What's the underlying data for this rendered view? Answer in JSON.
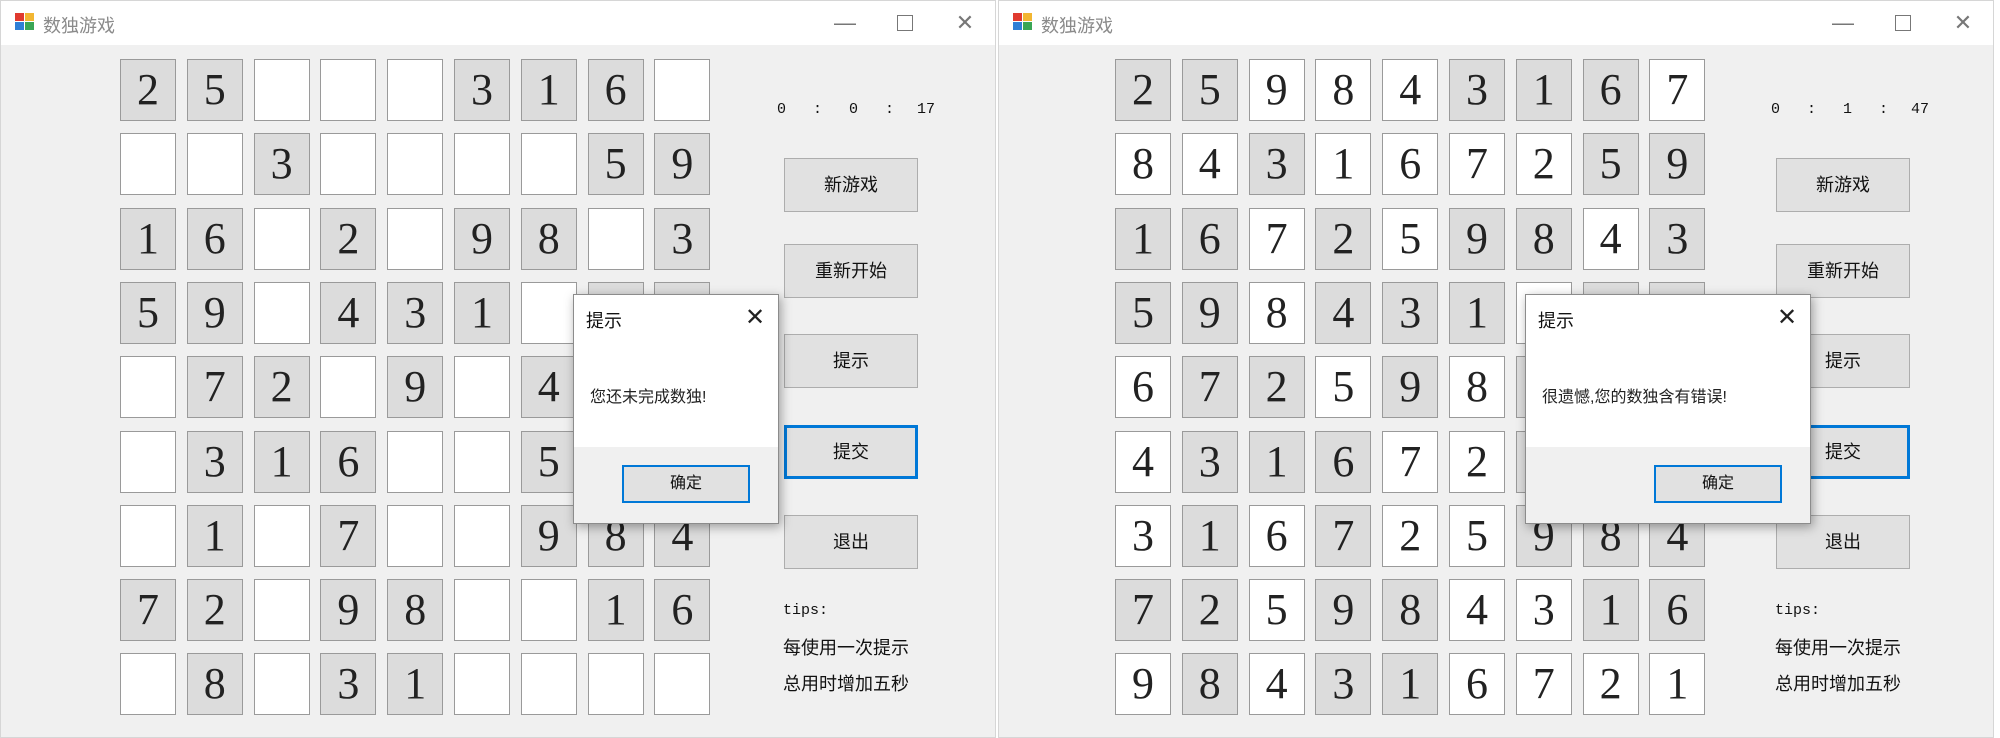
{
  "window_a": {
    "title": "数独游戏",
    "board": [
      [
        "2",
        "5",
        "",
        "",
        "",
        "3",
        "1",
        "6",
        ""
      ],
      [
        "",
        "",
        "3",
        "",
        "",
        "",
        "",
        "5",
        "9"
      ],
      [
        "1",
        "6",
        "",
        "2",
        "",
        "9",
        "8",
        "",
        "3"
      ],
      [
        "5",
        "9",
        "",
        "4",
        "3",
        "1",
        "",
        "",
        ""
      ],
      [
        "",
        "7",
        "2",
        "",
        "9",
        "",
        "4",
        "",
        ""
      ],
      [
        "",
        "3",
        "1",
        "6",
        "",
        "",
        "5",
        "",
        ""
      ],
      [
        "",
        "1",
        "",
        "7",
        "",
        "",
        "9",
        "8",
        "4"
      ],
      [
        "7",
        "2",
        "",
        "9",
        "8",
        "",
        "",
        "1",
        "6"
      ],
      [
        "",
        "8",
        "",
        "3",
        "1",
        "",
        "",
        "",
        ""
      ]
    ],
    "given": [
      [
        1,
        1,
        0,
        0,
        0,
        1,
        1,
        1,
        0
      ],
      [
        0,
        0,
        1,
        0,
        0,
        0,
        0,
        1,
        1
      ],
      [
        1,
        1,
        0,
        1,
        0,
        1,
        1,
        0,
        1
      ],
      [
        1,
        1,
        0,
        1,
        1,
        1,
        0,
        1,
        1
      ],
      [
        0,
        1,
        1,
        0,
        1,
        0,
        1,
        1,
        1
      ],
      [
        0,
        1,
        1,
        1,
        0,
        0,
        1,
        1,
        1
      ],
      [
        0,
        1,
        0,
        1,
        0,
        0,
        1,
        1,
        1
      ],
      [
        1,
        1,
        0,
        1,
        1,
        0,
        0,
        1,
        1
      ],
      [
        0,
        1,
        0,
        1,
        1,
        0,
        0,
        0,
        0
      ]
    ],
    "timer": {
      "hours": "0",
      "sep1": ":",
      "minutes": "0",
      "sep2": ":",
      "seconds": "17"
    },
    "buttons": {
      "new_game": "新游戏",
      "restart": "重新开始",
      "hint": "提示",
      "submit": "提交",
      "exit": "退出"
    },
    "tips": {
      "title": "tips:",
      "line1": "每使用一次提示",
      "line2": "总用时增加五秒"
    },
    "dialog": {
      "title": "提示",
      "message": "您还未完成数独!",
      "ok": "确定",
      "close": "✕"
    }
  },
  "window_b": {
    "title": "数独游戏",
    "board": [
      [
        "2",
        "5",
        "9",
        "8",
        "4",
        "3",
        "1",
        "6",
        "7"
      ],
      [
        "8",
        "4",
        "3",
        "1",
        "6",
        "7",
        "2",
        "5",
        "9"
      ],
      [
        "1",
        "6",
        "7",
        "2",
        "5",
        "9",
        "8",
        "4",
        "3"
      ],
      [
        "5",
        "9",
        "8",
        "4",
        "3",
        "1",
        "",
        "",
        ""
      ],
      [
        "6",
        "7",
        "2",
        "5",
        "9",
        "8",
        "",
        "",
        ""
      ],
      [
        "4",
        "3",
        "1",
        "6",
        "7",
        "2",
        "",
        "",
        ""
      ],
      [
        "3",
        "1",
        "6",
        "7",
        "2",
        "5",
        "9",
        "8",
        "4"
      ],
      [
        "7",
        "2",
        "5",
        "9",
        "8",
        "4",
        "3",
        "1",
        "6"
      ],
      [
        "9",
        "8",
        "4",
        "3",
        "1",
        "6",
        "7",
        "2",
        "1"
      ]
    ],
    "given": [
      [
        1,
        1,
        0,
        0,
        0,
        1,
        1,
        1,
        0
      ],
      [
        0,
        0,
        1,
        0,
        0,
        0,
        0,
        1,
        1
      ],
      [
        1,
        1,
        0,
        1,
        0,
        1,
        1,
        0,
        1
      ],
      [
        1,
        1,
        0,
        1,
        1,
        1,
        0,
        1,
        1
      ],
      [
        0,
        1,
        1,
        0,
        1,
        0,
        1,
        1,
        1
      ],
      [
        0,
        1,
        1,
        1,
        0,
        0,
        1,
        1,
        1
      ],
      [
        0,
        1,
        0,
        1,
        0,
        0,
        1,
        1,
        1
      ],
      [
        1,
        1,
        0,
        1,
        1,
        0,
        0,
        1,
        1
      ],
      [
        0,
        1,
        0,
        1,
        1,
        0,
        0,
        0,
        0
      ]
    ],
    "timer": {
      "hours": "0",
      "sep1": ":",
      "minutes": "1",
      "sep2": ":",
      "seconds": "47"
    },
    "buttons": {
      "new_game": "新游戏",
      "restart": "重新开始",
      "hint": "提示",
      "submit": "提交",
      "exit": "退出"
    },
    "tips": {
      "title": "tips:",
      "line1": "每使用一次提示",
      "line2": "总用时增加五秒"
    },
    "dialog": {
      "title": "提示",
      "message": "很遗憾,您的数独含有错误!",
      "ok": "确定",
      "close": "✕"
    }
  },
  "window_controls": {
    "minimize": "—",
    "close": "✕"
  },
  "icons": {
    "app": "app-window-icon",
    "minimize": "minimize-icon",
    "maximize": "maximize-icon",
    "close": "close-icon"
  },
  "colors": {
    "given_cell": "#dcdcdc",
    "empty_cell": "#ffffff",
    "focus_blue": "#0078d7",
    "window_bg": "#f0f0f0"
  }
}
